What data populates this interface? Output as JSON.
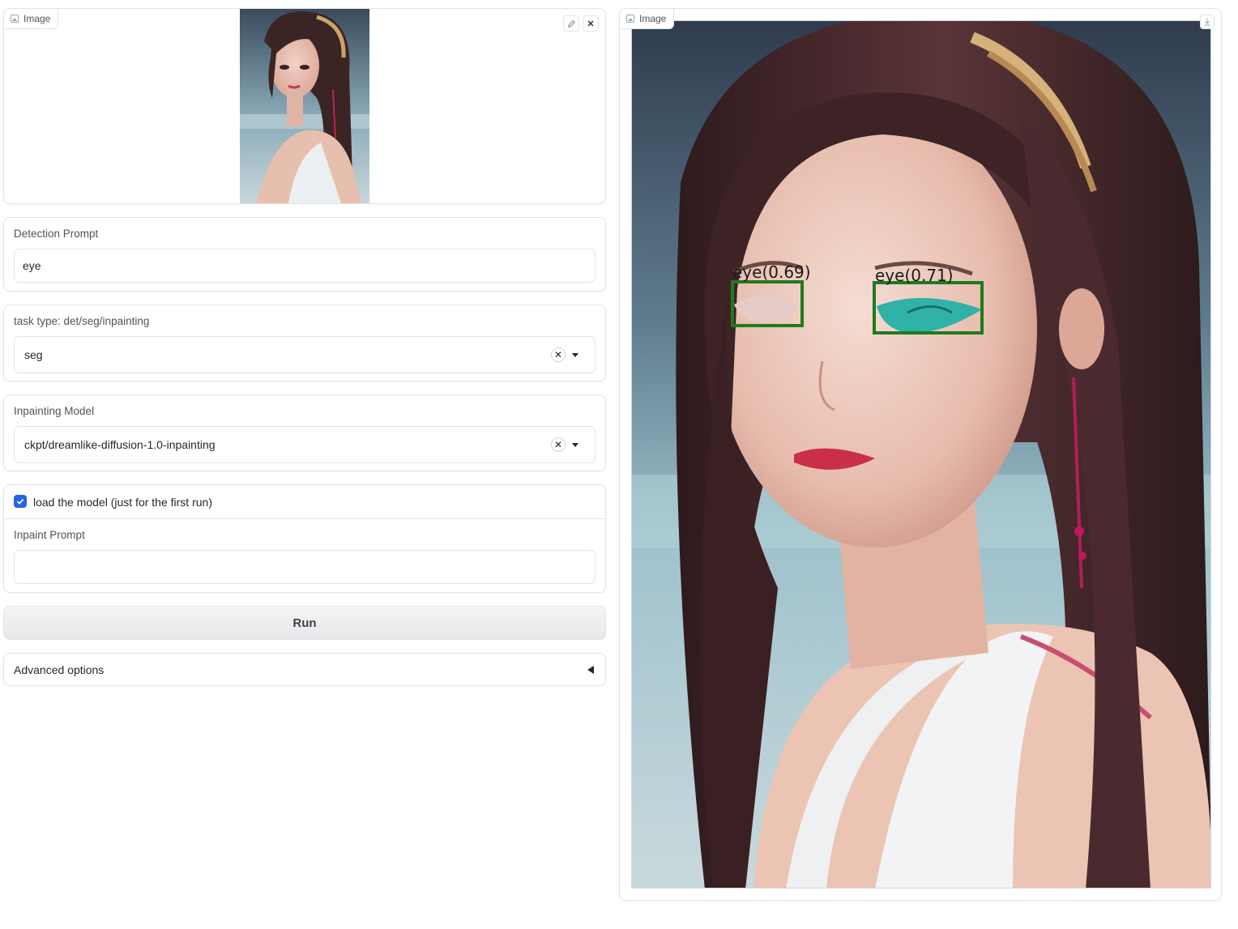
{
  "input_image": {
    "label": "Image",
    "edit_icon": "pencil-icon",
    "clear_icon": "close-icon"
  },
  "detection_prompt": {
    "label": "Detection Prompt",
    "value": "eye"
  },
  "task_type": {
    "label": "task type: det/seg/inpainting",
    "value": "seg"
  },
  "inpainting_model": {
    "label": "Inpainting Model",
    "value": "ckpt/dreamlike-diffusion-1.0-inpainting"
  },
  "load_model": {
    "label": "load the model (just for the first run)",
    "checked": true
  },
  "inpaint_prompt": {
    "label": "Inpaint Prompt",
    "value": ""
  },
  "run_button": {
    "label": "Run"
  },
  "advanced_options": {
    "label": "Advanced options",
    "collapsed": true
  },
  "output_image": {
    "label": "Image",
    "download_icon": "download-icon",
    "detections": [
      {
        "label": "eye(0.69)",
        "color": "#1f7a1f"
      },
      {
        "label": "eye(0.71)",
        "color": "#1f7a1f"
      }
    ]
  }
}
